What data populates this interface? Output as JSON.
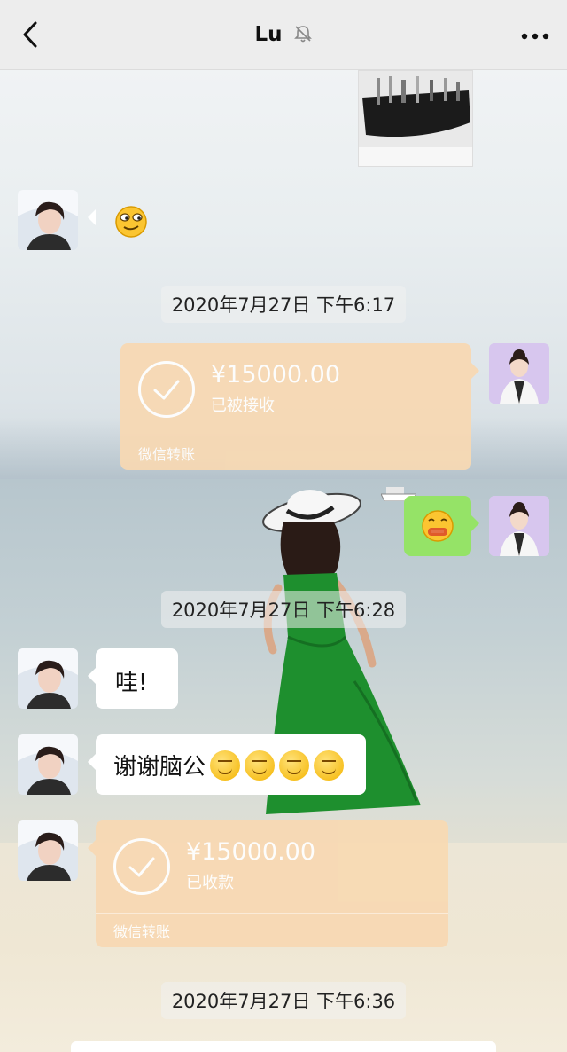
{
  "header": {
    "title": "Lu",
    "back_icon": "chevron-left-icon",
    "mute_icon": "bell-off-icon",
    "more_icon": "more-dots-icon"
  },
  "messages": {
    "time1": "2020年7月27日 下午6:17",
    "transfer1": {
      "amount": "¥15000.00",
      "status": "已被接收",
      "label": "微信转账"
    },
    "time2": "2020年7月27日 下午6:28",
    "text1": "哇!",
    "text2": "谢谢脑公",
    "transfer2": {
      "amount": "¥15000.00",
      "status": "已收款",
      "label": "微信转账"
    },
    "time3": "2020年7月27日 下午6:36"
  },
  "colors": {
    "transfer_bubble": "#f8d9b3",
    "sent_bubble": "#95e367",
    "topbar": "#ededed"
  }
}
